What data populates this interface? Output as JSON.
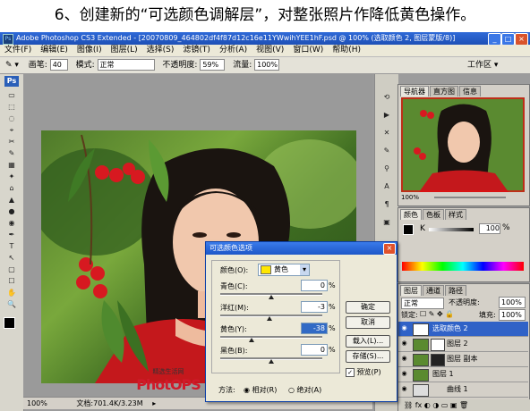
{
  "caption": "6、创建新的“可选颜色调解层”，对整张照片作降低黄色操作。",
  "window": {
    "title": "Adobe Photoshop CS3 Extended - [20070809_464802df4f87d12c16e11YWwihYEE1hF.psd @ 100% (选取颜色 2, 图层蒙版/8)]",
    "minimize": "_",
    "maximize": "□",
    "close": "×"
  },
  "menu": [
    "文件(F)",
    "编辑(E)",
    "图像(I)",
    "图层(L)",
    "选择(S)",
    "滤镜(T)",
    "分析(A)",
    "视图(V)",
    "窗口(W)",
    "帮助(H)"
  ],
  "workspace": "工作区 ▾",
  "options": {
    "brush_label": "画笔:",
    "brush_size": "40",
    "mode_label": "模式:",
    "mode_value": "正常",
    "opacity_label": "不透明度:",
    "opacity_value": "59%",
    "flow_label": "流量:",
    "flow_value": "100%"
  },
  "tools": [
    "▭",
    "⬚",
    "◌",
    "⌖",
    "✂",
    "✎",
    "▦",
    "✦",
    "⌂",
    "▲",
    "●",
    "◉",
    "✒",
    "T",
    "↖",
    "▢",
    "☐",
    "✋",
    "🔍"
  ],
  "status": {
    "zoom": "100%",
    "doc": "文档:701.4K/3.23M"
  },
  "navigator": {
    "tabs": [
      "导航器",
      "直方图",
      "信息"
    ],
    "zoom": "100%"
  },
  "color_panel": {
    "tabs": [
      "颜色",
      "色板",
      "样式"
    ],
    "channel": "K",
    "value": "100",
    "unit": "%"
  },
  "layers": {
    "tabs": [
      "图层",
      "通道",
      "路径"
    ],
    "blend": "正常",
    "opacity_label": "不透明度:",
    "opacity": "100%",
    "lock_label": "锁定:",
    "fill_label": "填充:",
    "fill": "100%",
    "items": [
      {
        "name": "选取颜色 2",
        "selected": true
      },
      {
        "name": "图层 2",
        "selected": false
      },
      {
        "name": "图层 副本",
        "selected": false
      },
      {
        "name": "图层 1",
        "selected": false
      },
      {
        "name": "曲线 1",
        "selected": false
      }
    ]
  },
  "dialog": {
    "title": "可选颜色选项",
    "colors_label": "颜色(O):",
    "colors_value": "黄色",
    "ok": "确定",
    "cancel": "取消",
    "load": "载入(L)...",
    "save": "存储(S)...",
    "preview": "预览(P)",
    "sliders": [
      {
        "label": "青色(C):",
        "value": "0",
        "pos": 0.5
      },
      {
        "label": "洋红(M):",
        "value": "-3",
        "pos": 0.485
      },
      {
        "label": "黄色(Y):",
        "value": "-38",
        "pos": 0.31
      },
      {
        "label": "黑色(B):",
        "value": "0",
        "pos": 0.5
      }
    ],
    "method_label": "方法:",
    "relative": "相对(R)",
    "absolute": "绝对(A)"
  },
  "watermark": {
    "sub": "精选生活网",
    "logo": "PhotOPS"
  },
  "colors": {
    "accent": "#1c56c8",
    "titlebar": "#2f6ad8"
  }
}
